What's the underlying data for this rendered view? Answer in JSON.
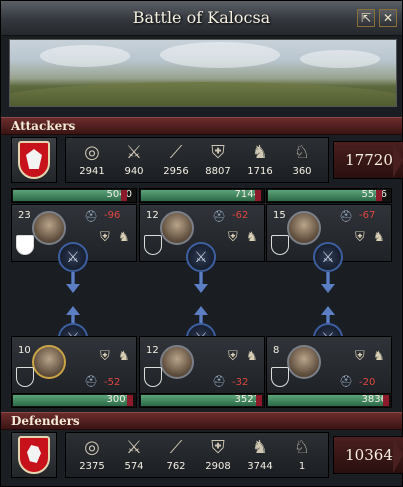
{
  "window": {
    "title": "Battle of Kalocsa"
  },
  "buttons": {
    "zoom_icon": "⇱",
    "close_icon": "✕"
  },
  "attackers": {
    "label": "Attackers",
    "total": "17720",
    "units": [
      {
        "icon": "archer-icon",
        "glyph": "◎",
        "count": "2941"
      },
      {
        "icon": "light-infantry-icon",
        "glyph": "⚔",
        "count": "940"
      },
      {
        "icon": "pikemen-icon",
        "glyph": "⟋",
        "count": "2956"
      },
      {
        "icon": "heavy-infantry-icon",
        "glyph": "⛨",
        "count": "8807"
      },
      {
        "icon": "light-cavalry-icon",
        "glyph": "♞",
        "count": "1716"
      },
      {
        "icon": "knights-icon",
        "glyph": "♘",
        "count": "360"
      }
    ],
    "flanks": [
      {
        "hp": "5040",
        "hp_fraction": 0.9,
        "skill": "23",
        "loss": "-96",
        "shield_color": "#d11a1a"
      },
      {
        "hp": "7144",
        "hp_fraction": 0.95,
        "skill": "12",
        "loss": "-62",
        "shield_color": "#5aa0e0"
      },
      {
        "hp": "5536",
        "hp_fraction": 0.9,
        "skill": "15",
        "loss": "-67",
        "shield_color": "#f0f0f0"
      }
    ]
  },
  "defenders": {
    "label": "Defenders",
    "total": "10364",
    "units": [
      {
        "icon": "archer-icon",
        "glyph": "◎",
        "count": "2375"
      },
      {
        "icon": "light-infantry-icon",
        "glyph": "⚔",
        "count": "574"
      },
      {
        "icon": "pikemen-icon",
        "glyph": "⟋",
        "count": "762"
      },
      {
        "icon": "heavy-infantry-icon",
        "glyph": "⛨",
        "count": "2908"
      },
      {
        "icon": "light-cavalry-icon",
        "glyph": "♞",
        "count": "3744"
      },
      {
        "icon": "knights-icon",
        "glyph": "♘",
        "count": "1"
      }
    ],
    "flanks": [
      {
        "hp": "3007",
        "hp_fraction": 0.95,
        "skill": "10",
        "loss": "-52",
        "shield_color": "#d4a017"
      },
      {
        "hp": "3521",
        "hp_fraction": 0.96,
        "skill": "12",
        "loss": "-32",
        "shield_color": "#d4a017"
      },
      {
        "hp": "3836",
        "hp_fraction": 0.96,
        "skill": "8",
        "loss": "-20",
        "shield_color": "#2b4f9e"
      }
    ]
  },
  "colors": {
    "accent": "#6b2c2c",
    "hp_green": "#4a9a6a",
    "loss_red": "#e0453f"
  }
}
